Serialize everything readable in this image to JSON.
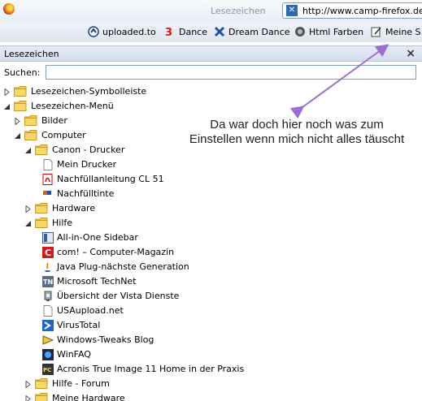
{
  "topbar": {
    "menu_label": "Lesezeichen",
    "url": "http://www.camp-firefox.de"
  },
  "bookmarks_toolbar": [
    {
      "label": "uploaded.to",
      "icon": "uploaded-icon"
    },
    {
      "label": "Dance",
      "icon": "dance-icon"
    },
    {
      "label": "Dream Dance",
      "icon": "dream-dance-icon"
    },
    {
      "label": "Html Farben",
      "icon": "html-farben-icon"
    },
    {
      "label": "Meine S",
      "icon": "edit-icon"
    }
  ],
  "sidebar": {
    "title": "Lesezeichen",
    "close": "×",
    "search_label": "Suchen:",
    "search_value": ""
  },
  "annotation": {
    "line1": "Da war doch hier noch was zum",
    "line2": "Einstellen wenn mich nicht alles täuscht",
    "color": "#9b6fd1"
  },
  "tree": [
    {
      "label": "Lesezeichen-Symbolleiste",
      "type": "folder",
      "level": 0,
      "state": "collapsed"
    },
    {
      "label": "Lesezeichen-Menü",
      "type": "folder",
      "level": 0,
      "state": "expanded"
    },
    {
      "label": "Bilder",
      "type": "folder",
      "level": 1,
      "state": "collapsed"
    },
    {
      "label": "Computer",
      "type": "folder",
      "level": 1,
      "state": "expanded"
    },
    {
      "label": "Canon - Drucker",
      "type": "folder",
      "level": 2,
      "state": "expanded"
    },
    {
      "label": "Mein Drucker",
      "type": "bookmark",
      "level": 3,
      "icon": "page-icon"
    },
    {
      "label": "Nachfüllanleitung CL 51",
      "type": "bookmark",
      "level": 3,
      "icon": "pdf-icon"
    },
    {
      "label": "Nachfülltinte",
      "type": "bookmark",
      "level": 3,
      "icon": "ink-icon"
    },
    {
      "label": "Hardware",
      "type": "folder",
      "level": 2,
      "state": "collapsed"
    },
    {
      "label": "Hilfe",
      "type": "folder",
      "level": 2,
      "state": "expanded"
    },
    {
      "label": "All-in-One Sidebar",
      "type": "bookmark",
      "level": 3,
      "icon": "sidebar-icon"
    },
    {
      "label": "com! – Computer-Magazin",
      "type": "bookmark",
      "level": 3,
      "icon": "com-icon"
    },
    {
      "label": "Java Plug-nächste Generation",
      "type": "bookmark",
      "level": 3,
      "icon": "java-icon"
    },
    {
      "label": "Microsoft TechNet",
      "type": "bookmark",
      "level": 3,
      "icon": "technet-icon"
    },
    {
      "label": "Übersicht der Vista Dienste",
      "type": "bookmark",
      "level": 3,
      "icon": "vista-icon"
    },
    {
      "label": "USAupload.net",
      "type": "bookmark",
      "level": 3,
      "icon": "page-icon"
    },
    {
      "label": "VirusTotal",
      "type": "bookmark",
      "level": 3,
      "icon": "virustotal-icon"
    },
    {
      "label": "Windows-Tweaks Blog",
      "type": "bookmark",
      "level": 3,
      "icon": "tweaks-icon"
    },
    {
      "label": "WinFAQ",
      "type": "bookmark",
      "level": 3,
      "icon": "winfaq-icon"
    },
    {
      "label": "Acronis True Image 11 Home in der Praxis",
      "type": "bookmark",
      "level": 3,
      "icon": "acronis-icon"
    },
    {
      "label": "Hilfe - Forum",
      "type": "folder",
      "level": 2,
      "state": "collapsed"
    },
    {
      "label": "Meine Hardware",
      "type": "folder",
      "level": 2,
      "state": "collapsed"
    }
  ]
}
